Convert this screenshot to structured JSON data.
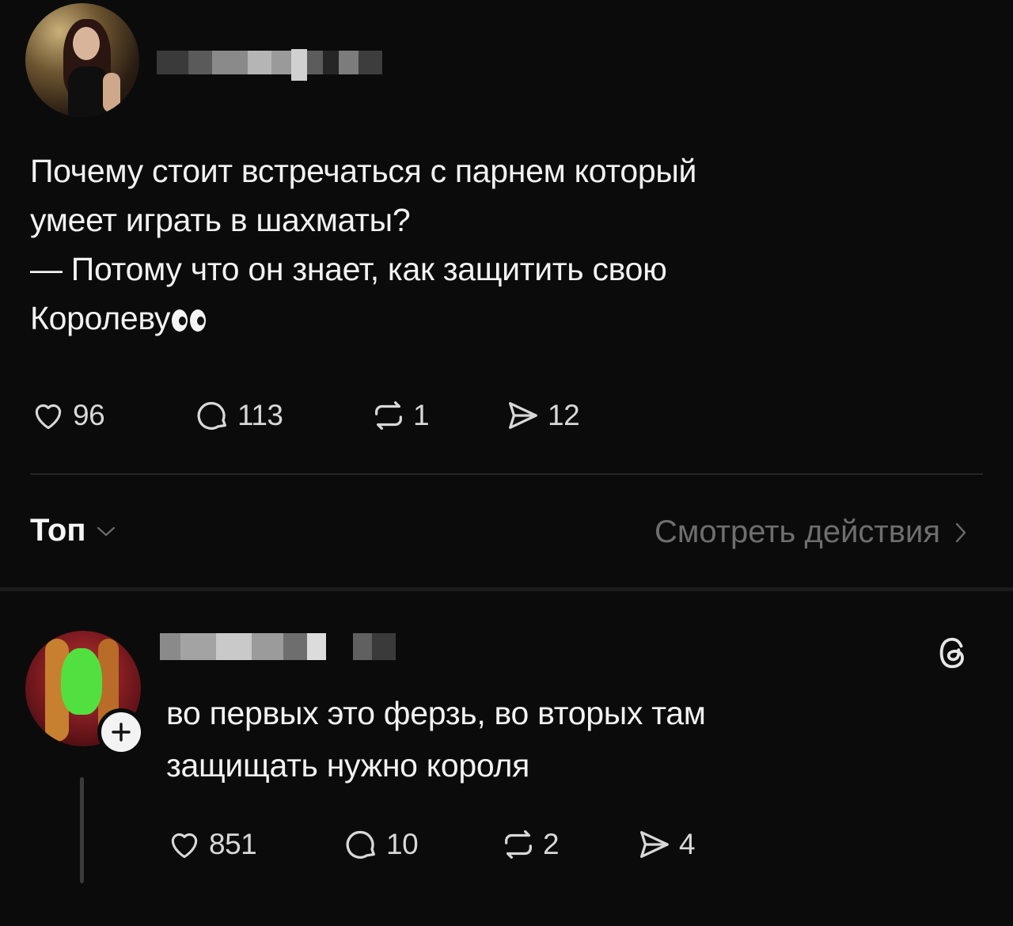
{
  "post": {
    "author_name": "",
    "text_lines": [
      "Почему стоит встречаться с парнем который",
      "умеет играть в шахматы?",
      "— Потому что он знает, как защитить свою",
      "Королеву"
    ],
    "emoji": "eyes",
    "stats": {
      "likes": "96",
      "comments": "113",
      "reposts": "1",
      "shares": "12"
    }
  },
  "thread_bar": {
    "sort_label": "Топ",
    "view_activity_label": "Смотреть действия"
  },
  "reply": {
    "author_name": "",
    "text_lines": [
      "во первых это ферзь, во вторых там",
      "защищать нужно короля"
    ],
    "stats": {
      "likes": "851",
      "comments": "10",
      "reposts": "2",
      "shares": "4"
    }
  },
  "icons": {
    "like": "heart-icon",
    "comment": "comment-bubble-icon",
    "repost": "repost-icon",
    "share": "send-icon",
    "follow": "plus-icon",
    "app": "threads-logo-icon"
  },
  "colors": {
    "background": "#0b0b0b",
    "text": "#f2f2f2",
    "muted": "#6e6e6e",
    "divider": "#262626"
  }
}
